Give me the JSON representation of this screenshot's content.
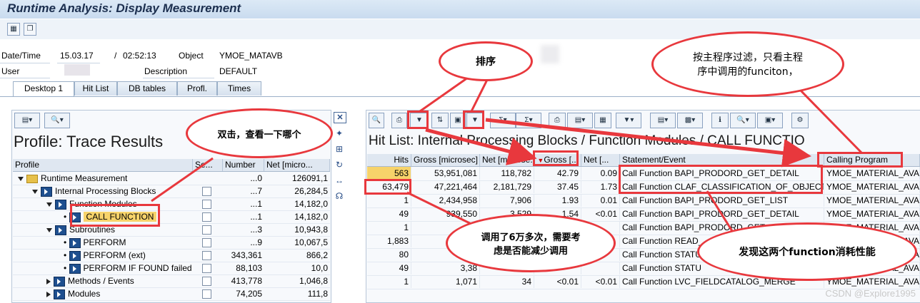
{
  "window": {
    "title": "Runtime Analysis: Display Measurement"
  },
  "header": {
    "date_label": "Date/Time",
    "date_value": "15.03.17",
    "sep": "/",
    "time_value": "02:52:13",
    "object_label": "Object",
    "object_value": "YMOE_MATAVB",
    "user_label": "User",
    "description_label": "Description",
    "description_value": "DEFAULT"
  },
  "tabs": [
    {
      "label": "Desktop 1",
      "active": true
    },
    {
      "label": "Hit List"
    },
    {
      "label": "DB tables"
    },
    {
      "label": "Profl."
    },
    {
      "label": "Times"
    }
  ],
  "left": {
    "title": "Profile: Trace Results",
    "columns": [
      "Profile",
      "Se...",
      "Number",
      "Net [micro..."
    ],
    "rows": [
      {
        "label": "Runtime Measurement",
        "number": "...0",
        "net": "126091,1"
      },
      {
        "label": "Internal Processing Blocks",
        "number": "...7",
        "net": "26,284,5"
      },
      {
        "label": "Function Modules",
        "number": "...1",
        "net": "14,182,0"
      },
      {
        "label": "CALL FUNCTION",
        "number": "...1",
        "net": "14,182,0"
      },
      {
        "label": "Subroutines",
        "number": "...3",
        "net": "10,943,8"
      },
      {
        "label": "PERFORM",
        "number": "...9",
        "net": "10,067,5"
      },
      {
        "label": "PERFORM (ext)",
        "number": "343,361",
        "net": "866,2"
      },
      {
        "label": "PERFORM IF FOUND failed",
        "number": "88,103",
        "net": "10,0"
      },
      {
        "label": "Methods / Events",
        "number": "413,778",
        "net": "1,046,8"
      },
      {
        "label": "Modules",
        "number": "74,205",
        "net": "111,8"
      }
    ]
  },
  "right": {
    "title": "Hit List: Internal Processing Blocks / Function Modules / CALL FUNCTIO",
    "columns": [
      "Hits",
      "Gross [microsec]",
      "Net [microse...",
      "Gross [...",
      "Net [...",
      "Statement/Event",
      "Calling Program"
    ],
    "rows": [
      {
        "hits": "563",
        "gross": "53,951,081",
        "net": "118,782",
        "gp": "42.79",
        "np": "0.09",
        "stmt": "Call Function BAPI_PRODORD_GET_DETAIL",
        "prog": "YMOE_MATERIAL_AVA"
      },
      {
        "hits": "63,479",
        "gross": "47,221,464",
        "net": "2,181,729",
        "gp": "37.45",
        "np": "1.73",
        "stmt": "Call Function CLAF_CLASSIFICATION_OF_OBJECTS",
        "prog": "YMOE_MATERIAL_AVA"
      },
      {
        "hits": "1",
        "gross": "2,434,958",
        "net": "7,906",
        "gp": "1.93",
        "np": "0.01",
        "stmt": "Call Function BAPI_PRODORD_GET_LIST",
        "prog": "YMOE_MATERIAL_AVA"
      },
      {
        "hits": "49",
        "gross": "939,550",
        "net": "3,529",
        "gp": "1.54",
        "np": "<0.01",
        "stmt": "Call Function BAPI_PRODORD_GET_DETAIL",
        "prog": "YMOE_MATERIAL_AVA"
      },
      {
        "hits": "1",
        "gross": "1,",
        "net": "",
        "gp": "",
        "np": "",
        "stmt": "Call Function BAPI_PRODORD_GET_LIST",
        "prog": "YMOE_MATERIAL_AVA"
      },
      {
        "hits": "1,883",
        "gross": "57",
        "net": "",
        "gp": "",
        "np": "",
        "stmt": "Call Function READ_",
        "prog": "YMOE_MATERIAL_AVA"
      },
      {
        "hits": "80",
        "gross": "4,",
        "net": "",
        "gp": "",
        "np": "",
        "stmt": "Call Function STATU",
        "prog": "YMOE_MATERIAL_AVA"
      },
      {
        "hits": "49",
        "gross": "3,38",
        "net": "",
        "gp": "",
        "np": "",
        "stmt": "Call Function STATU",
        "prog": "YMOE_MATERIAL_AVA"
      },
      {
        "hits": "1",
        "gross": "1,071",
        "net": "34",
        "gp": "<0.01",
        "np": "<0.01",
        "stmt": "Call Function LVC_FIELDCATALOG_MERGE",
        "prog": "YMOE_MATERIAL_AVA"
      }
    ]
  },
  "callouts": {
    "sort": "排序",
    "filter": "按主程序过滤，只看主程序中调用的funciton，",
    "dblclick": "双击，查看一下哪个",
    "calls": "调用了6万多次，需要考虑是否能减少调用",
    "perf": "发现这两个function消耗性能"
  },
  "watermark": "CSDN @Explore1995",
  "accent_color": "#e8383d"
}
